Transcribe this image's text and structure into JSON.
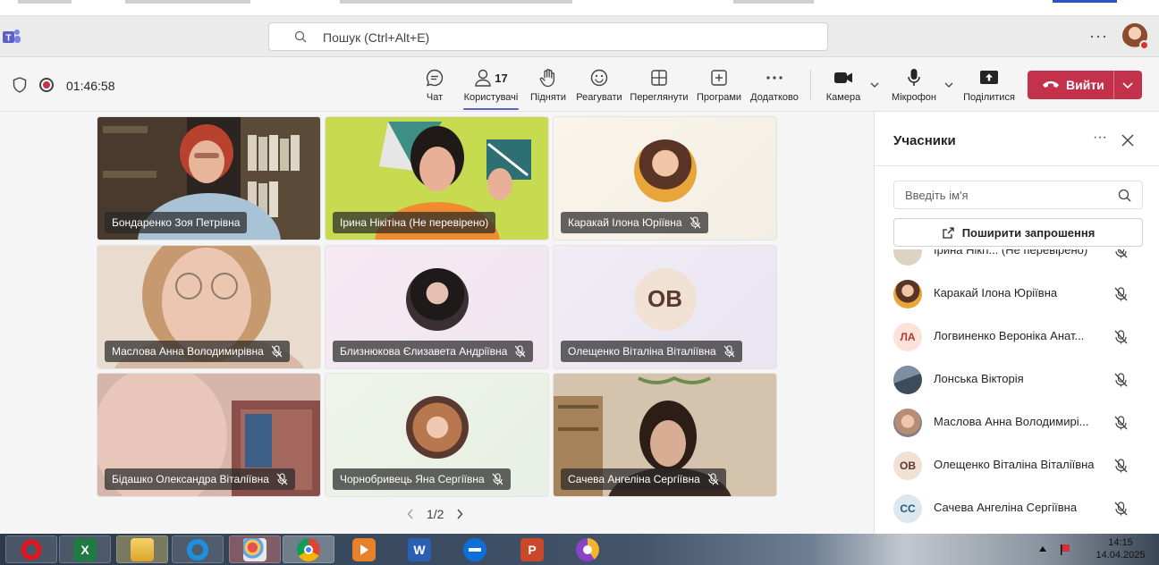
{
  "titlebar": {
    "search_placeholder": "Пошук (Ctrl+Alt+E)",
    "more_icon": "more-horizontal-icon"
  },
  "toolbar": {
    "timer": "01:46:58",
    "items": [
      {
        "label": "Чат",
        "icon": "chat-icon"
      },
      {
        "label": "Користувачі",
        "icon": "people-icon",
        "count": "17"
      },
      {
        "label": "Підняти",
        "icon": "raise-hand-icon"
      },
      {
        "label": "Реагувати",
        "icon": "smiley-icon"
      },
      {
        "label": "Переглянути",
        "icon": "view-grid-icon"
      },
      {
        "label": "Програми",
        "icon": "apps-plus-icon"
      },
      {
        "label": "Додатково",
        "icon": "more-icon"
      },
      {
        "label": "Камера",
        "icon": "camera-icon"
      },
      {
        "label": "Мікрофон",
        "icon": "microphone-icon"
      },
      {
        "label": "Поділитися",
        "icon": "share-screen-icon"
      }
    ],
    "leave_label": "Вийти"
  },
  "colors": {
    "accent": "#5b5fc7",
    "leave": "#c4314b",
    "recording": "#c4314b"
  },
  "tiles": [
    {
      "name": "Бондаренко Зоя Петрівна",
      "muted": false,
      "kind": "video"
    },
    {
      "name": "Ірина Нікітіна (Не перевірено)",
      "muted": false,
      "kind": "video"
    },
    {
      "name": "Каракай Ілона Юріївна",
      "muted": true,
      "kind": "photo"
    },
    {
      "name": "Маслова Анна Володимирівна",
      "muted": true,
      "kind": "video"
    },
    {
      "name": "Близнюкова Єлизавета Андріївна",
      "muted": true,
      "kind": "photo"
    },
    {
      "name": "Олещенко Віталіна Віталіївна",
      "muted": true,
      "kind": "initials",
      "initials": "ОВ"
    },
    {
      "name": "Бідашко Олександра Віталіївна",
      "muted": true,
      "kind": "video"
    },
    {
      "name": "Чорнобривець Яна Сергіївна",
      "muted": true,
      "kind": "photo"
    },
    {
      "name": "Сачева Ангеліна Сергіївна",
      "muted": true,
      "kind": "video"
    }
  ],
  "pager": {
    "text": "1/2"
  },
  "panel": {
    "title": "Учасники",
    "search_placeholder": "Введіть ім'я",
    "invite_label": "Поширити запрошення",
    "participants": [
      {
        "name": "Ірина Нікіт... (Не перевірено)",
        "avatar": "photo"
      },
      {
        "name": "Каракай Ілона Юріївна",
        "avatar": "photo"
      },
      {
        "name": "Логвиненко Вероніка Анат...",
        "avatar": "initials",
        "initials": "ЛА"
      },
      {
        "name": "Лонська Вікторія",
        "avatar": "photo"
      },
      {
        "name": "Маслова Анна Володимирі...",
        "avatar": "photo"
      },
      {
        "name": "Олещенко Віталіна Віталіївна",
        "avatar": "initials",
        "initials": "ОВ"
      },
      {
        "name": "Сачева Ангеліна Сергіївна",
        "avatar": "initials",
        "initials": "СС"
      }
    ]
  },
  "taskbar": {
    "apps": [
      "opera-icon",
      "excel-icon",
      "file-explorer-icon",
      "internet-explorer-icon",
      "paint-icon",
      "chrome-icon",
      "media-player-icon",
      "word-icon",
      "teamviewer-icon",
      "powerpoint-icon",
      "vpn-icon"
    ],
    "excel_letter": "X",
    "word_letter": "W",
    "powerpoint_letter": "P",
    "time": "14:15",
    "date": "14.04.2025"
  }
}
